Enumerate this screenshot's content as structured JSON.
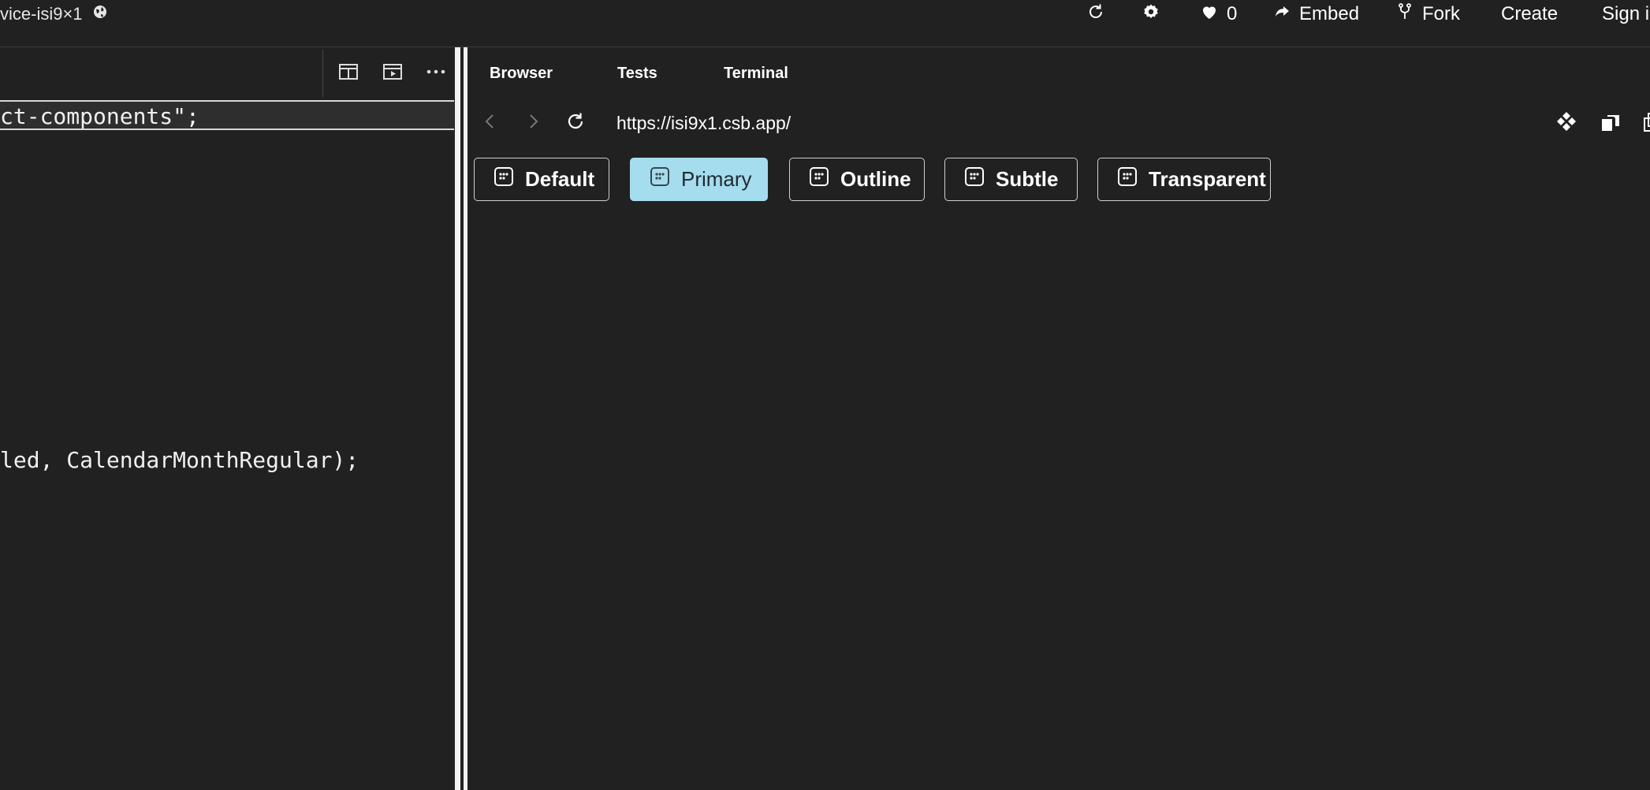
{
  "topbar": {
    "sandbox_name": "vice-isi9×1",
    "likes_count": "0",
    "embed_label": "Embed",
    "fork_label": "Fork",
    "create_label": "Create",
    "signin_label": "Sign i"
  },
  "editor": {
    "active_line": "ct-components\";",
    "line_2": "led, CalendarMonthRegular);"
  },
  "preview": {
    "tabs": [
      "Browser",
      "Tests",
      "Terminal"
    ],
    "url": "https://isi9x1.csb.app/",
    "buttons": [
      {
        "label": "Default",
        "appearance": "default"
      },
      {
        "label": "Primary",
        "appearance": "primary"
      },
      {
        "label": "Outline",
        "appearance": "outline"
      },
      {
        "label": "Subtle",
        "appearance": "subtle"
      },
      {
        "label": "Transparent",
        "appearance": "transparent"
      }
    ]
  },
  "colors": {
    "background": "#212121",
    "primary_button": "#a5dcee",
    "divider": "#f2f2f2"
  },
  "icons": {
    "globe": "globe-icon",
    "refresh": "refresh-icon",
    "settings": "gear-icon",
    "like": "heart-icon",
    "embed": "share-arrow-icon",
    "fork": "fork-icon",
    "split_view": "split-view-icon",
    "preview": "preview-icon",
    "more": "more-icon",
    "back": "chevron-left-icon",
    "forward": "chevron-right-icon",
    "reload": "reload-icon",
    "devtools": "devtools-icon",
    "open_window": "open-window-icon",
    "button_icon": "calendar-month-icon"
  }
}
